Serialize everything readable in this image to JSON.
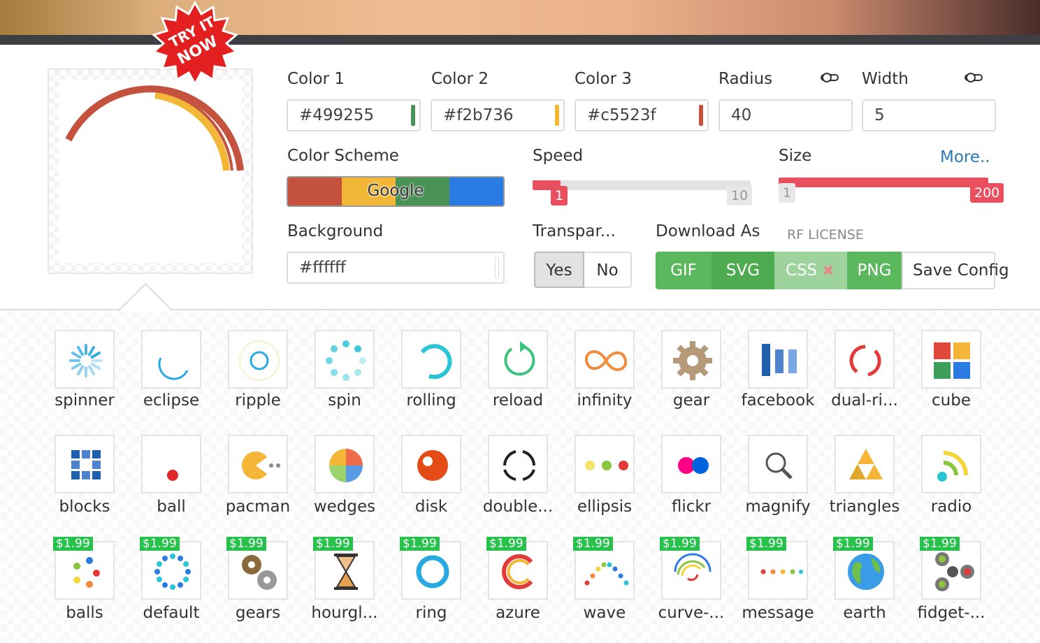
{
  "badge": {
    "line1": "TRY IT",
    "line2": "NOW"
  },
  "colors": {
    "color1": {
      "label": "Color 1",
      "value": "#499255",
      "swatch": "#499255"
    },
    "color2": {
      "label": "Color 2",
      "value": "#f2b736",
      "swatch": "#f2b736"
    },
    "color3": {
      "label": "Color 3",
      "value": "#c5523f",
      "swatch": "#c5523f"
    }
  },
  "radius": {
    "label": "Radius",
    "value": "40"
  },
  "width": {
    "label": "Width",
    "value": "5"
  },
  "scheme": {
    "label": "Color Scheme",
    "name": "Google",
    "colors": [
      "#c5523f",
      "#f2b736",
      "#499255",
      "#2a7ce4"
    ]
  },
  "speed": {
    "label": "Speed",
    "min": "1",
    "max": "10",
    "value": 1
  },
  "size": {
    "label": "Size",
    "min": "1",
    "max": "200",
    "value": 200,
    "more_link": "More.."
  },
  "background": {
    "label": "Background",
    "value": "#ffffff"
  },
  "transparent": {
    "label": "Transpar...",
    "yes": "Yes",
    "no": "No",
    "selected": "Yes"
  },
  "download": {
    "label": "Download As",
    "license": "RF LICENSE",
    "gif": "GIF",
    "svg": "SVG",
    "css": "CSS",
    "png": "PNG",
    "save": "Save Config"
  },
  "gallery": {
    "row1": [
      "spinner",
      "eclipse",
      "ripple",
      "spin",
      "rolling",
      "reload",
      "infinity",
      "gear",
      "facebook",
      "dual-ri...",
      "cube"
    ],
    "row2": [
      "blocks",
      "ball",
      "pacman",
      "wedges",
      "disk",
      "double...",
      "ellipsis",
      "flickr",
      "magnify",
      "triangles",
      "radio"
    ],
    "row3": [
      "balls",
      "default",
      "gears",
      "hourgl...",
      "ring",
      "azure",
      "wave",
      "curve-...",
      "message",
      "earth",
      "fidget-..."
    ],
    "price": "$1.99"
  }
}
